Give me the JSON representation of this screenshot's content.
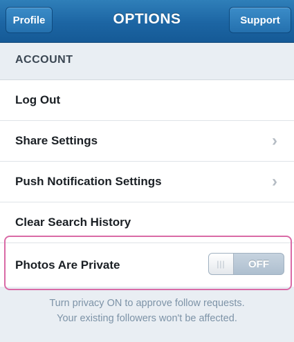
{
  "navbar": {
    "left_button": "Profile",
    "title": "OPTIONS",
    "right_button": "Support"
  },
  "account": {
    "header": "ACCOUNT",
    "rows": [
      {
        "label": "Log Out",
        "chevron": false
      },
      {
        "label": "Share Settings",
        "chevron": true,
        "icon": "chevron-right-icon"
      },
      {
        "label": "Push Notification Settings",
        "chevron": true,
        "icon": "chevron-right-icon"
      },
      {
        "label": "Clear Search History",
        "chevron": false
      }
    ],
    "privacy": {
      "label": "Photos Are Private",
      "toggle_state": "OFF"
    }
  },
  "footnote": {
    "line1": "Turn privacy ON to approve follow requests.",
    "line2": "Your existing followers won't be affected."
  },
  "colors": {
    "navbar": "#1c65a3",
    "highlight_border": "#d96aa6",
    "footnote_text": "#7d93a7"
  }
}
